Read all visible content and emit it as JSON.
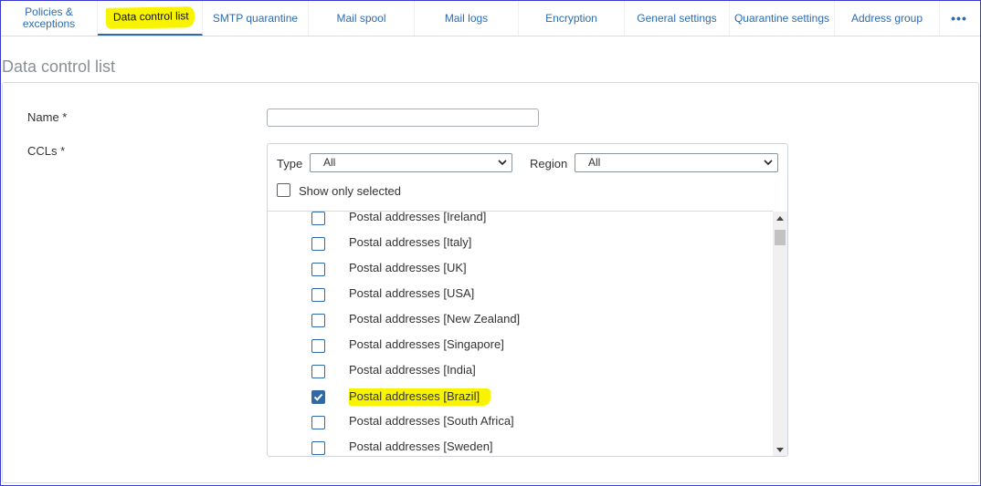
{
  "tabs": [
    {
      "label": "Policies &\nexceptions",
      "active": false
    },
    {
      "label": "Data control list",
      "active": true
    },
    {
      "label": "SMTP quarantine",
      "active": false
    },
    {
      "label": "Mail spool",
      "active": false
    },
    {
      "label": "Mail logs",
      "active": false
    },
    {
      "label": "Encryption",
      "active": false
    },
    {
      "label": "General settings",
      "active": false
    },
    {
      "label": "Quarantine settings",
      "active": false
    },
    {
      "label": "Address group",
      "active": false
    },
    {
      "label": "•••",
      "active": false
    }
  ],
  "page": {
    "title": "Data control list"
  },
  "form": {
    "name_label": "Name *",
    "name_value": "",
    "ccls_label": "CCLs *",
    "type_label": "Type",
    "type_value": "All",
    "region_label": "Region",
    "region_value": "All",
    "show_selected_label": "Show only selected",
    "show_selected_checked": false
  },
  "ccl_items": [
    {
      "label": "Postal addresses [Ireland]",
      "checked": false
    },
    {
      "label": "Postal addresses [Italy]",
      "checked": false
    },
    {
      "label": "Postal addresses [UK]",
      "checked": false
    },
    {
      "label": "Postal addresses [USA]",
      "checked": false
    },
    {
      "label": "Postal addresses [New Zealand]",
      "checked": false
    },
    {
      "label": "Postal addresses [Singapore]",
      "checked": false
    },
    {
      "label": "Postal addresses [India]",
      "checked": false
    },
    {
      "label": "Postal addresses [Brazil]",
      "checked": true
    },
    {
      "label": "Postal addresses [South Africa]",
      "checked": false
    },
    {
      "label": "Postal addresses [Sweden]",
      "checked": false
    }
  ],
  "colors": {
    "accent": "#2b6cb0",
    "highlight": "#f8f400",
    "checkbox": "#2f6aa6"
  }
}
